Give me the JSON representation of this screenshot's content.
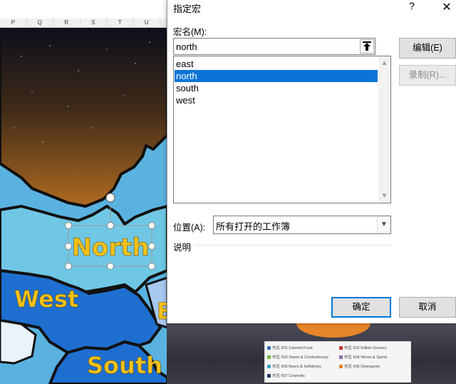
{
  "sheet": {
    "columns": [
      "P",
      "Q",
      "R",
      "S",
      "T",
      "U"
    ],
    "map_labels": {
      "north": "North",
      "west": "West",
      "south": "South",
      "east": "E"
    },
    "legend": [
      {
        "text": "东区 601 Canned Food",
        "color": "#3b6fb6"
      },
      {
        "text": "东区 602 Edible Grocery",
        "color": "#c0392b"
      },
      {
        "text": "东区 603 Sweet & Confectionary",
        "color": "#7ab648"
      },
      {
        "text": "东区 604 Wines & Spirits",
        "color": "#8e6fb4"
      },
      {
        "text": "东区 605 Beers & Softdrinks",
        "color": "#3aa6c9"
      },
      {
        "text": "东区 606 Detergents",
        "color": "#e7852a"
      },
      {
        "text": "东区 607 Cosmetic",
        "color": "#1f3a6b"
      }
    ]
  },
  "dialog": {
    "title": "指定宏",
    "help": "?",
    "close": "✕",
    "macro_name_label": "宏名(M):",
    "macro_name_value": "north",
    "macros": [
      "east",
      "north",
      "south",
      "west"
    ],
    "selected_index": 1,
    "edit_button": "编辑(E)",
    "record_button": "录制(R)...",
    "location_label": "位置(A):",
    "location_value": "所有打开的工作簿",
    "description_label": "说明",
    "ok_button": "确定",
    "cancel_button": "取消"
  },
  "colors": {
    "selection": "#0a75d6",
    "map_sea": "#5ab2e0",
    "map_land_dark": "#1e6fd0",
    "label_yellow": "#f2c21b"
  }
}
